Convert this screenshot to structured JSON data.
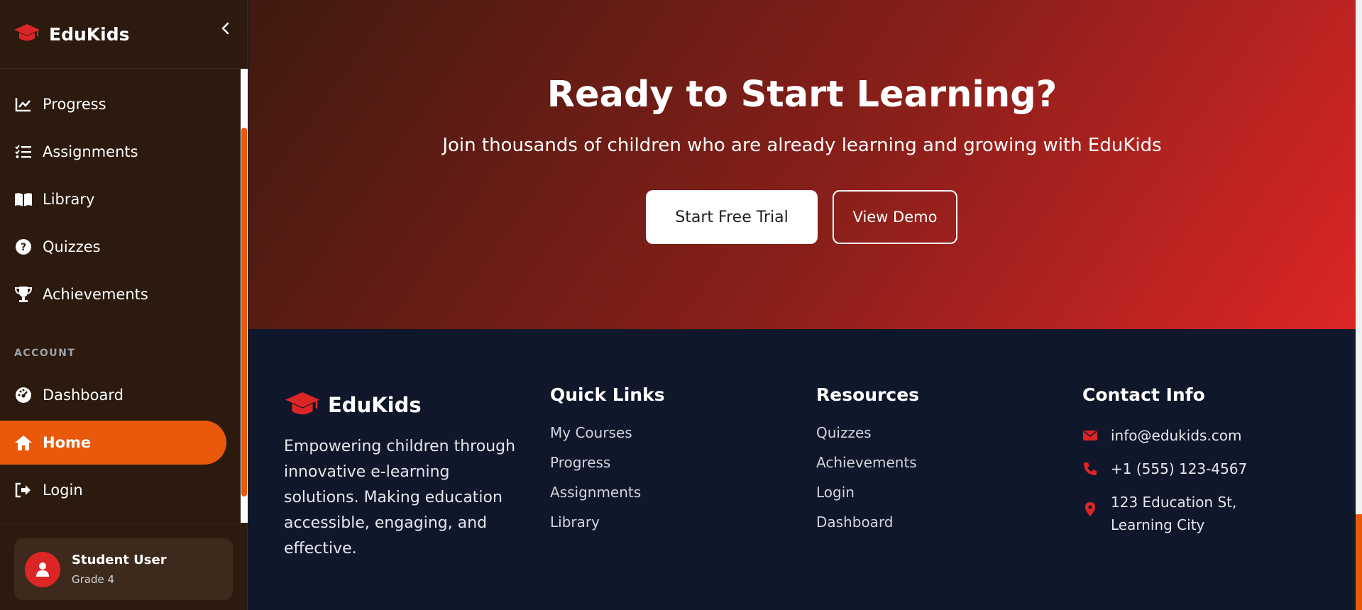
{
  "sidebar": {
    "brand": "EduKids",
    "section_account": "ACCOUNT",
    "items": [
      {
        "label": "Progress",
        "icon": "chart-line-icon"
      },
      {
        "label": "Assignments",
        "icon": "list-check-icon"
      },
      {
        "label": "Library",
        "icon": "book-open-icon"
      },
      {
        "label": "Quizzes",
        "icon": "question-circle-icon"
      },
      {
        "label": "Achievements",
        "icon": "trophy-icon"
      }
    ],
    "account_items": [
      {
        "label": "Dashboard",
        "icon": "gauge-icon"
      },
      {
        "label": "Home",
        "icon": "home-icon",
        "active": true
      },
      {
        "label": "Login",
        "icon": "sign-in-icon"
      }
    ],
    "user": {
      "name": "Student User",
      "grade": "Grade 4"
    }
  },
  "hero": {
    "title": "Ready to Start Learning?",
    "subtitle": "Join thousands of children who are already learning and growing with EduKids",
    "primary_button": "Start Free Trial",
    "secondary_button": "View Demo"
  },
  "footer": {
    "brand": "EduKids",
    "description": "Empowering children through innovative e-learning solutions. Making education accessible, engaging, and effective.",
    "quick_links": {
      "title": "Quick Links",
      "links": [
        "My Courses",
        "Progress",
        "Assignments",
        "Library"
      ]
    },
    "resources": {
      "title": "Resources",
      "links": [
        "Quizzes",
        "Achievements",
        "Login",
        "Dashboard"
      ]
    },
    "contact": {
      "title": "Contact Info",
      "email": "info@edukids.com",
      "phone": "+1 (555) 123-4567",
      "address": "123 Education St, Learning City"
    }
  },
  "colors": {
    "accent": "#ea580c",
    "brand_red": "#dc2626",
    "sidebar_bg": "#2b1a0d",
    "footer_bg": "#0f172a"
  }
}
